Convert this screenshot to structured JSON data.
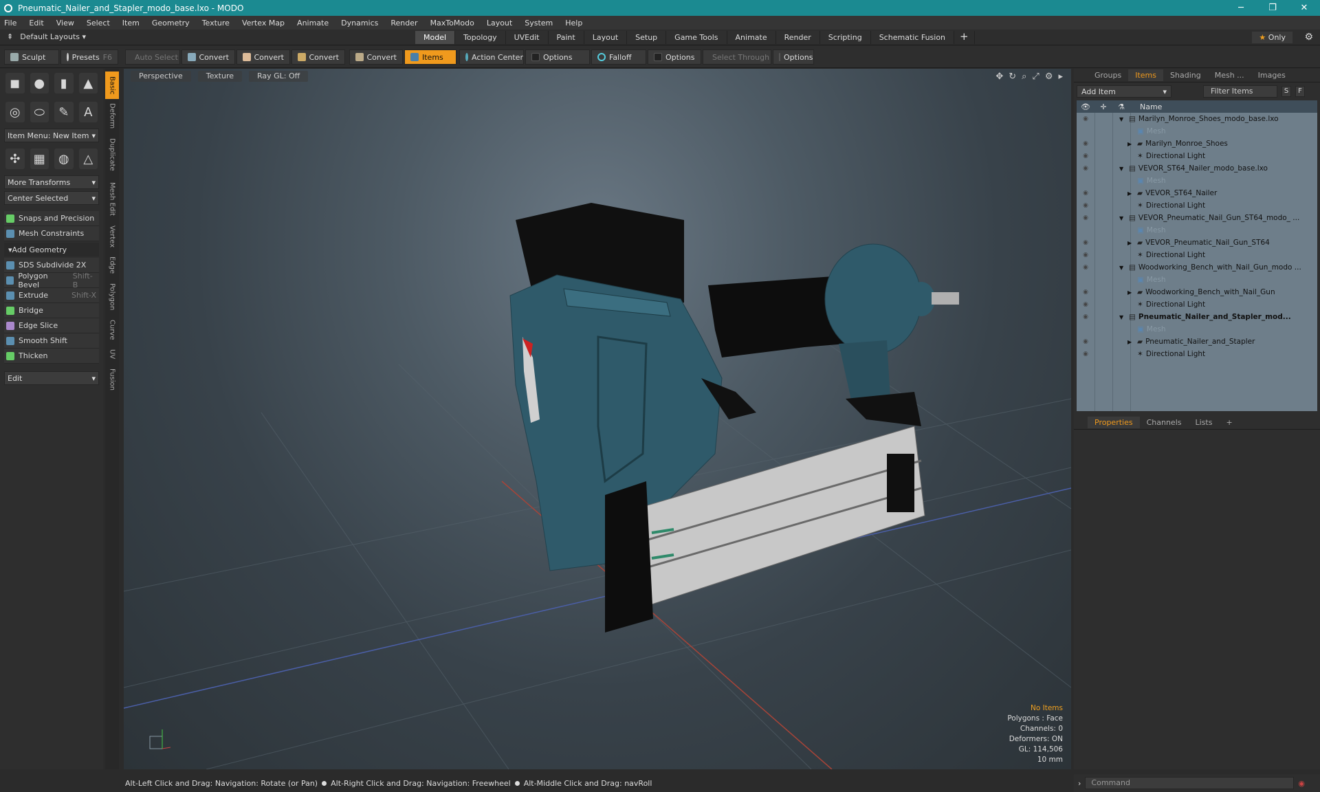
{
  "window": {
    "title": "Pneumatic_Nailer_and_Stapler_modo_base.lxo - MODO",
    "controls": [
      "─",
      "❐",
      "✕"
    ]
  },
  "menu": [
    "File",
    "Edit",
    "View",
    "Select",
    "Item",
    "Geometry",
    "Texture",
    "Vertex Map",
    "Animate",
    "Dynamics",
    "Render",
    "MaxToModo",
    "Layout",
    "System",
    "Help"
  ],
  "layouts": {
    "label": "Default Layouts ▾"
  },
  "tabs": [
    "Model",
    "Topology",
    "UVEdit",
    "Paint",
    "Layout",
    "Setup",
    "Game Tools",
    "Animate",
    "Render",
    "Scripting",
    "Schematic Fusion"
  ],
  "active_tab": "Model",
  "only": {
    "star": "★",
    "label": "Only"
  },
  "toolbar": {
    "sculpt": "Sculpt",
    "presets": "Presets",
    "presets_key": "F6",
    "auto_select": "Auto Select",
    "convert1": "Convert",
    "convert2": "Convert",
    "convert3": "Convert",
    "convert4": "Convert",
    "items": "Items",
    "action_center": "Action Center",
    "options1": "Options",
    "falloff": "Falloff",
    "options2": "Options",
    "select_through": "Select Through",
    "options3": "Options"
  },
  "left": {
    "item_menu": "Item Menu: New Item",
    "more_transforms": "More Transforms",
    "center_selected": "Center Selected",
    "snaps": "Snaps and Precision",
    "mesh_constraints": "Mesh Constraints",
    "add_geometry": "Add Geometry",
    "tools": [
      {
        "label": "SDS Subdivide 2X",
        "shortcut": ""
      },
      {
        "label": "Polygon Bevel",
        "shortcut": "Shift-B"
      },
      {
        "label": "Extrude",
        "shortcut": "Shift-X"
      },
      {
        "label": "Bridge",
        "shortcut": ""
      },
      {
        "label": "Edge Slice",
        "shortcut": ""
      },
      {
        "label": "Smooth Shift",
        "shortcut": ""
      },
      {
        "label": "Thicken",
        "shortcut": ""
      }
    ],
    "edit": "Edit"
  },
  "vtabs": [
    "Basic",
    "Deform",
    "Duplicate",
    "Mesh Edit",
    "Vertex",
    "Edge",
    "Polygon",
    "Curve",
    "UV",
    "Fusion"
  ],
  "viewport": {
    "view": "Perspective",
    "shading": "Texture",
    "raygl": "Ray GL: Off",
    "info": {
      "noitems": "No Items",
      "polygons": "Polygons : Face",
      "channels": "Channels: 0",
      "deformers": "Deformers: ON",
      "gl": "GL: 114,506",
      "scale": "10 mm"
    }
  },
  "right": {
    "tabs": [
      "Groups",
      "Items",
      "Shading",
      "Mesh ...",
      "Images"
    ],
    "add_item": "Add Item",
    "filter": "Filter Items",
    "s": "S",
    "f": "F",
    "name_header": "Name",
    "tree": [
      {
        "name": "Marilyn_Monroe_Shoes_modo_base.lxo",
        "level": 0,
        "arrow": "▼",
        "type": "scene"
      },
      {
        "name": "Mesh",
        "level": 1,
        "arrow": "",
        "type": "mesh",
        "dim": true
      },
      {
        "name": "Marilyn_Monroe_Shoes",
        "level": 1,
        "arrow": "▶",
        "type": "group"
      },
      {
        "name": "Directional Light",
        "level": 1,
        "arrow": "",
        "type": "light"
      },
      {
        "name": "VEVOR_ST64_Nailer_modo_base.lxo",
        "level": 0,
        "arrow": "▼",
        "type": "scene"
      },
      {
        "name": "Mesh",
        "level": 1,
        "arrow": "",
        "type": "mesh",
        "dim": true
      },
      {
        "name": "VEVOR_ST64_Nailer",
        "level": 1,
        "arrow": "▶",
        "type": "group"
      },
      {
        "name": "Directional Light",
        "level": 1,
        "arrow": "",
        "type": "light"
      },
      {
        "name": "VEVOR_Pneumatic_Nail_Gun_ST64_modo_ ...",
        "level": 0,
        "arrow": "▼",
        "type": "scene"
      },
      {
        "name": "Mesh",
        "level": 1,
        "arrow": "",
        "type": "mesh",
        "dim": true
      },
      {
        "name": "VEVOR_Pneumatic_Nail_Gun_ST64",
        "level": 1,
        "arrow": "▶",
        "type": "group"
      },
      {
        "name": "Directional Light",
        "level": 1,
        "arrow": "",
        "type": "light"
      },
      {
        "name": "Woodworking_Bench_with_Nail_Gun_modo ...",
        "level": 0,
        "arrow": "▼",
        "type": "scene"
      },
      {
        "name": "Mesh",
        "level": 1,
        "arrow": "",
        "type": "mesh",
        "dim": true
      },
      {
        "name": "Woodworking_Bench_with_Nail_Gun",
        "level": 1,
        "arrow": "▶",
        "type": "group"
      },
      {
        "name": "Directional Light",
        "level": 1,
        "arrow": "",
        "type": "light"
      },
      {
        "name": "Pneumatic_Nailer_and_Stapler_mod...",
        "level": 0,
        "arrow": "▼",
        "type": "scene",
        "bold": true
      },
      {
        "name": "Mesh",
        "level": 1,
        "arrow": "",
        "type": "mesh",
        "dim": true
      },
      {
        "name": "Pneumatic_Nailer_and_Stapler",
        "level": 1,
        "arrow": "▶",
        "type": "group"
      },
      {
        "name": "Directional Light",
        "level": 1,
        "arrow": "",
        "type": "light"
      }
    ],
    "prop_tabs": [
      "Properties",
      "Channels",
      "Lists"
    ]
  },
  "status": {
    "hint1": "Alt-Left Click and Drag: Navigation: Rotate (or Pan)",
    "hint2": "Alt-Right Click and Drag: Navigation: Freewheel",
    "hint3": "Alt-Middle Click and Drag: navRoll"
  },
  "command": {
    "placeholder": "Command"
  },
  "colors": {
    "accent": "#f09a1d",
    "titlebar": "#1b8a91",
    "tree_bg": "#6e7e8a",
    "tool_body": "#2f5a6a"
  }
}
